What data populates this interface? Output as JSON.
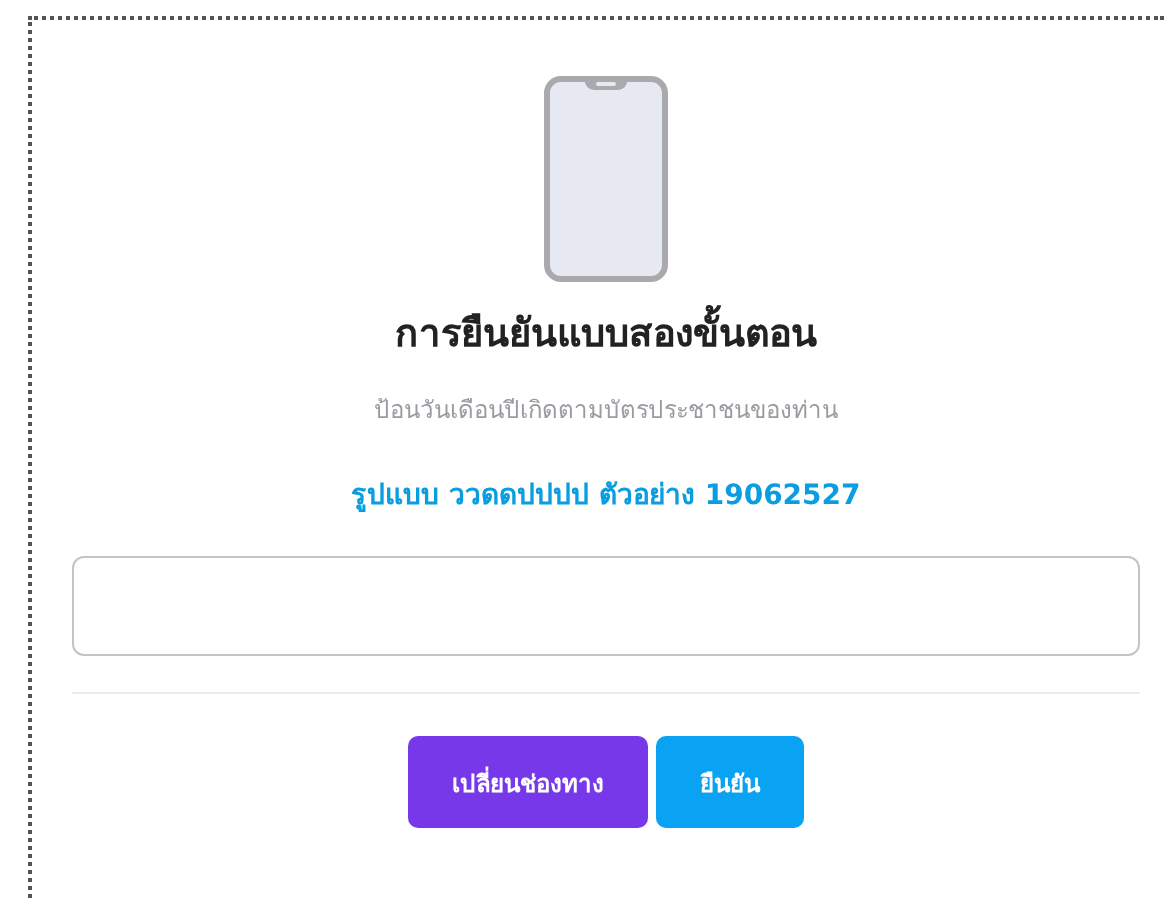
{
  "title": "การยืนยันแบบสองขั้นตอน",
  "subtitle": "ป้อนวันเดือนปีเกิดตามบัตรประชาชนของท่าน",
  "format_hint": "รูปแบบ ววดดปปปป ตัวอย่าง 19062527",
  "buttons": [
    {
      "label": "เปลี่ยนช่องทาง",
      "kind": "secondary"
    },
    {
      "label": "ยืนยัน",
      "kind": "primary"
    }
  ]
}
